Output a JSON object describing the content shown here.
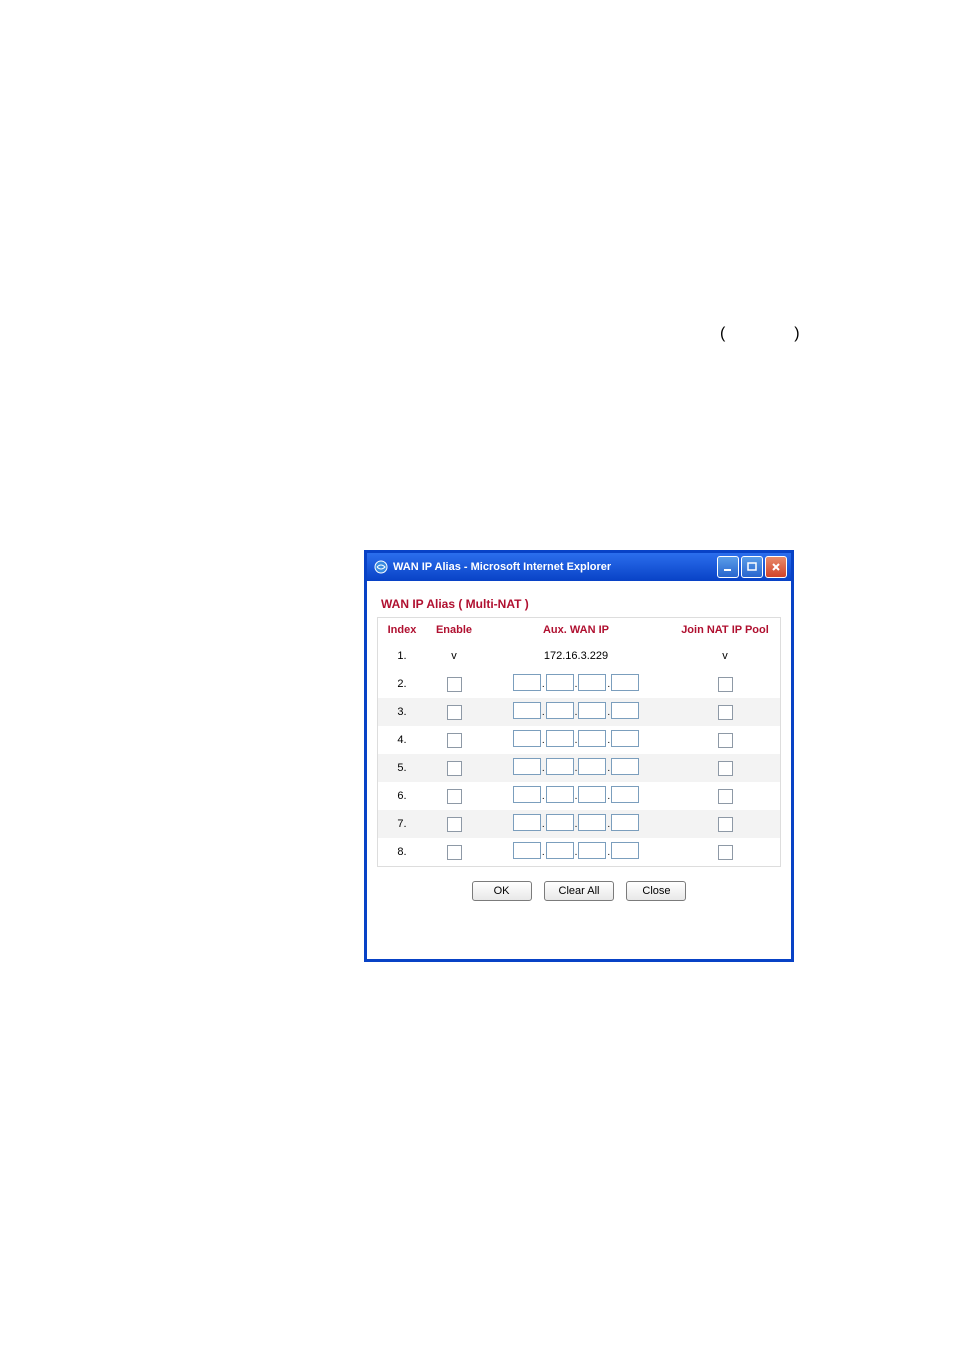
{
  "paren": {
    "open": "(",
    "close": ")"
  },
  "window": {
    "title": "WAN IP Alias - Microsoft Internet Explorer"
  },
  "section": {
    "title": "WAN IP Alias ( Multi-NAT )"
  },
  "headers": {
    "index": "Index",
    "enable": "Enable",
    "auxip": "Aux. WAN IP",
    "natpool": "Join NAT IP Pool"
  },
  "rows": [
    {
      "index": "1.",
      "enable": "v",
      "auxip": "172.16.3.229",
      "natpool": "v"
    },
    {
      "index": "2."
    },
    {
      "index": "3."
    },
    {
      "index": "4."
    },
    {
      "index": "5."
    },
    {
      "index": "6."
    },
    {
      "index": "7."
    },
    {
      "index": "8."
    }
  ],
  "buttons": {
    "ok": "OK",
    "clear": "Clear All",
    "close": "Close"
  }
}
